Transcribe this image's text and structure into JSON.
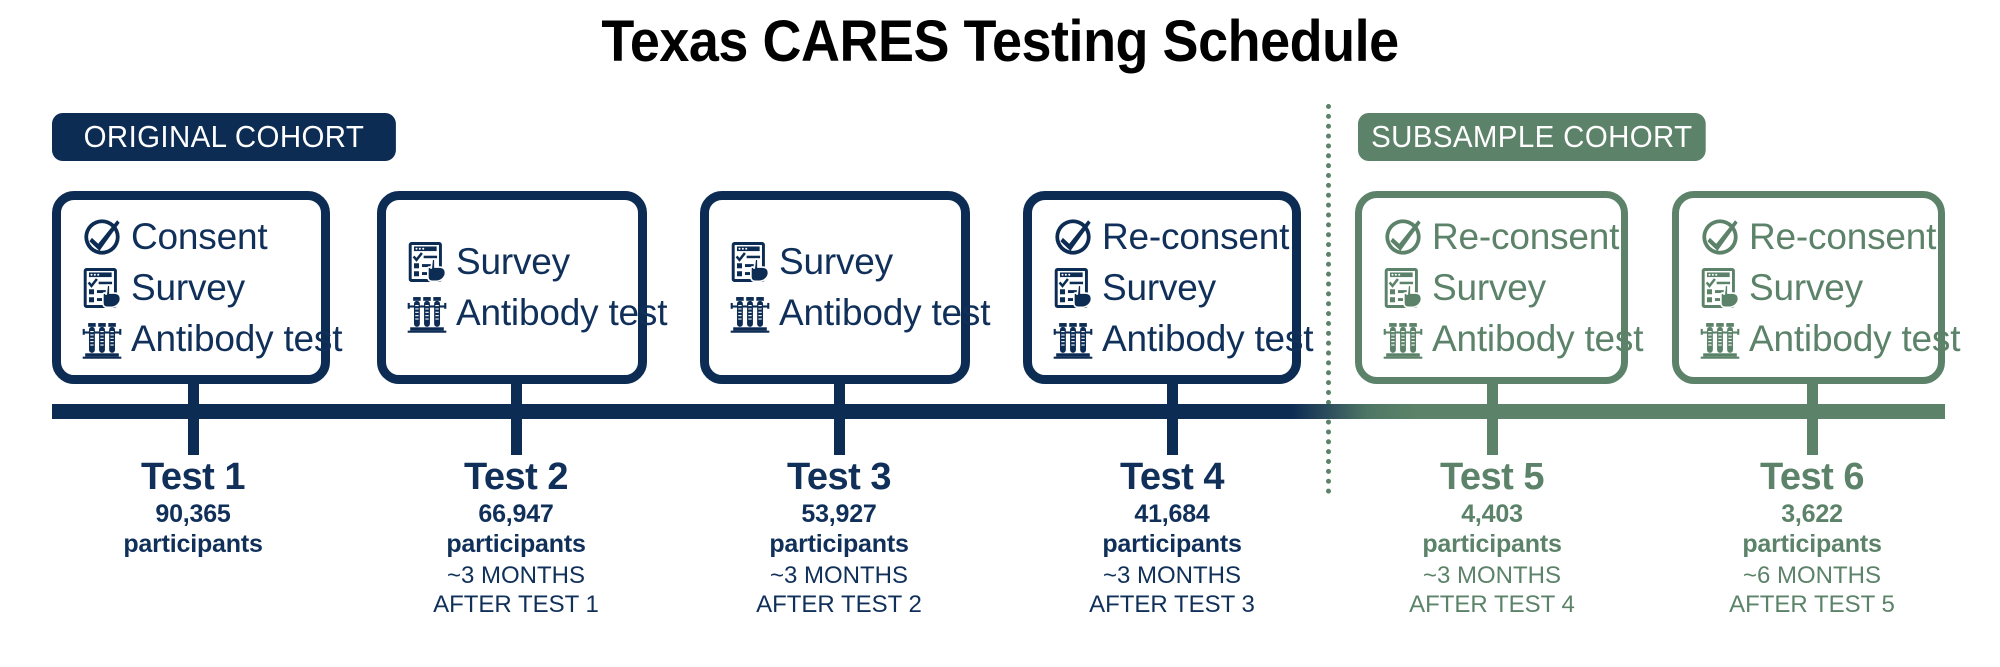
{
  "title": "Texas CARES Testing Schedule",
  "colors": {
    "navy": "#0d2c54",
    "green": "#5c8369",
    "title": "#000000",
    "background": "#ffffff"
  },
  "cohorts": [
    {
      "id": "original",
      "label": "ORIGINAL COHORT",
      "color": "#0d2c54"
    },
    {
      "id": "subsample",
      "label": "SUBSAMPLE COHORT",
      "color": "#5c8369"
    }
  ],
  "divider": {
    "style": "dotted",
    "color": "#5c8369"
  },
  "icons": {
    "consent": "check-circle-icon",
    "survey": "clipboard-hand-icon",
    "antibody": "test-tube-rack-icon"
  },
  "timeline": {
    "tests": [
      {
        "id": "test-1",
        "cohort": "original",
        "name": "Test 1",
        "count": "90,365",
        "unit": "participants",
        "gap_line1": "",
        "gap_line2": "",
        "items": [
          {
            "icon": "check-circle-icon",
            "label": "Consent"
          },
          {
            "icon": "clipboard-hand-icon",
            "label": "Survey"
          },
          {
            "icon": "test-tube-rack-icon",
            "label": "Antibody test"
          }
        ]
      },
      {
        "id": "test-2",
        "cohort": "original",
        "name": "Test 2",
        "count": "66,947",
        "unit": "participants",
        "gap_line1": "~3 MONTHS",
        "gap_line2": "AFTER TEST 1",
        "items": [
          {
            "icon": "clipboard-hand-icon",
            "label": "Survey"
          },
          {
            "icon": "test-tube-rack-icon",
            "label": "Antibody test"
          }
        ]
      },
      {
        "id": "test-3",
        "cohort": "original",
        "name": "Test 3",
        "count": "53,927",
        "unit": "participants",
        "gap_line1": "~3 MONTHS",
        "gap_line2": "AFTER TEST 2",
        "items": [
          {
            "icon": "clipboard-hand-icon",
            "label": "Survey"
          },
          {
            "icon": "test-tube-rack-icon",
            "label": "Antibody test"
          }
        ]
      },
      {
        "id": "test-4",
        "cohort": "original",
        "name": "Test 4",
        "count": "41,684",
        "unit": "participants",
        "gap_line1": "~3 MONTHS",
        "gap_line2": "AFTER TEST 3",
        "items": [
          {
            "icon": "check-circle-icon",
            "label": "Re-consent"
          },
          {
            "icon": "clipboard-hand-icon",
            "label": "Survey"
          },
          {
            "icon": "test-tube-rack-icon",
            "label": "Antibody test"
          }
        ]
      },
      {
        "id": "test-5",
        "cohort": "subsample",
        "name": "Test 5",
        "count": "4,403",
        "unit": "participants",
        "gap_line1": "~3 MONTHS",
        "gap_line2": "AFTER TEST 4",
        "items": [
          {
            "icon": "check-circle-icon",
            "label": "Re-consent"
          },
          {
            "icon": "clipboard-hand-icon",
            "label": "Survey"
          },
          {
            "icon": "test-tube-rack-icon",
            "label": "Antibody test"
          }
        ]
      },
      {
        "id": "test-6",
        "cohort": "subsample",
        "name": "Test 6",
        "count": "3,622",
        "unit": "participants",
        "gap_line1": "~6 MONTHS",
        "gap_line2": "AFTER TEST 5",
        "items": [
          {
            "icon": "check-circle-icon",
            "label": "Re-consent"
          },
          {
            "icon": "clipboard-hand-icon",
            "label": "Survey"
          },
          {
            "icon": "test-tube-rack-icon",
            "label": "Antibody test"
          }
        ]
      }
    ]
  }
}
